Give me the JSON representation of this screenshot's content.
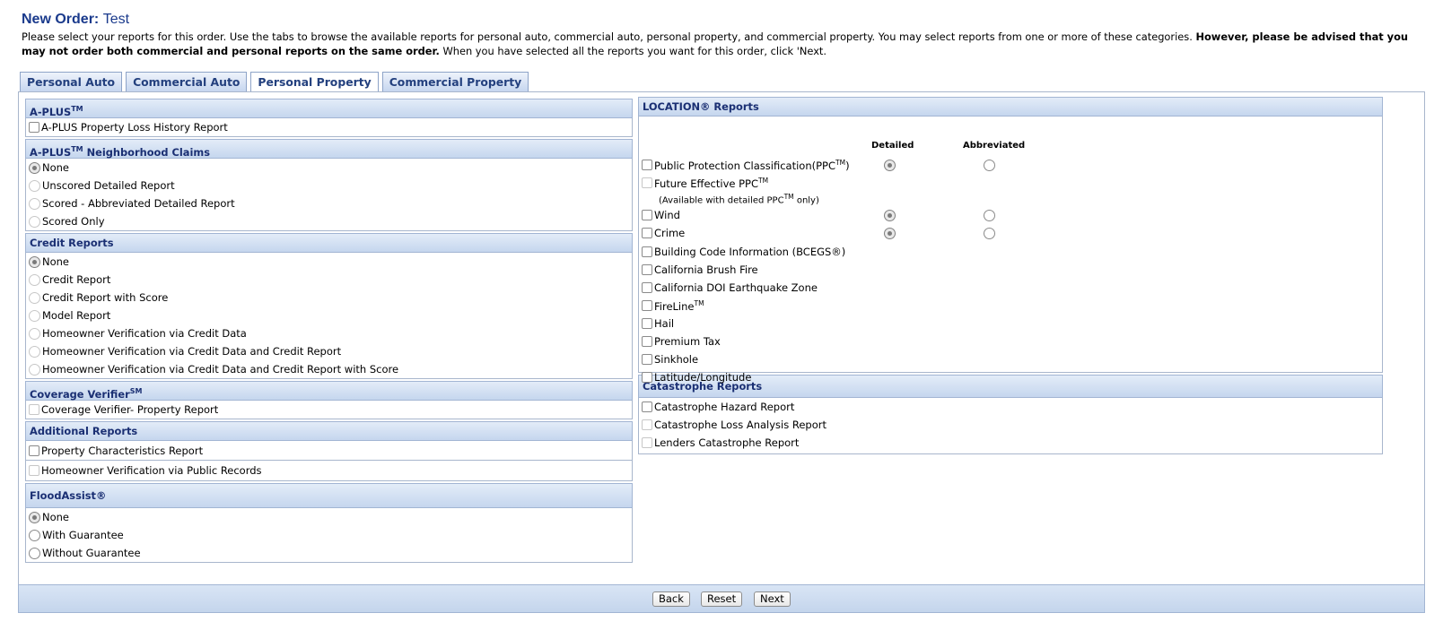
{
  "header": {
    "title_prefix": "New Order:",
    "title_name": "Test",
    "intro_text": "Please select your reports for this order. Use the tabs to browse the available reports for personal auto, commercial auto, personal property, and commercial property. You may select reports from one or more of these categories.",
    "intro_bold": "However, please be advised that you may not order both commercial and personal reports on the same order.",
    "intro_tail": "When you have selected all the reports you want for this order, click 'Next."
  },
  "tabs": [
    {
      "label": "Personal Auto",
      "active": false
    },
    {
      "label": "Commercial Auto",
      "active": false
    },
    {
      "label": "Personal Property",
      "active": true
    },
    {
      "label": "Commercial Property",
      "active": false
    }
  ],
  "left": {
    "aplus": {
      "title": "A-PLUS",
      "title_sup": "TM",
      "items": [
        "A-PLUS Property Loss History Report"
      ]
    },
    "neighborhood": {
      "title": "A-PLUS",
      "title_sup": "TM",
      "title_rest": " Neighborhood Claims",
      "options": [
        "None",
        "Unscored Detailed Report",
        "Scored - Abbreviated Detailed Report",
        "Scored Only"
      ],
      "selected": "None"
    },
    "credit": {
      "title": "Credit Reports",
      "options": [
        "None",
        "Credit Report",
        "Credit Report with Score",
        "Model Report",
        "Homeowner Verification via Credit Data",
        "Homeowner Verification via Credit Data and Credit Report",
        "Homeowner Verification via Credit Data and Credit Report with Score"
      ],
      "selected": "None"
    },
    "coverage": {
      "title": "Coverage Verifier",
      "title_sup": "SM",
      "items": [
        "Coverage Verifier- Property Report"
      ]
    },
    "additional": {
      "title": "Additional Reports",
      "items": [
        "Property Characteristics Report",
        "Homeowner Verification via Public Records"
      ]
    },
    "flood": {
      "title": "FloodAssist®",
      "options": [
        "None",
        "With Guarantee",
        "Without Guarantee"
      ],
      "selected": "None"
    }
  },
  "right": {
    "location": {
      "title": "LOCATION® Reports",
      "col_detailed": "Detailed",
      "col_abbreviated": "Abbreviated",
      "ppc_label": "Public Protection Classification(PPC",
      "ppc_sup": "TM",
      "ppc_close": ")",
      "future_label": "Future Effective PPC",
      "future_sup": "TM",
      "future_note_a": "(Available with detailed PPC",
      "future_note_sup": "TM",
      "future_note_b": " only)",
      "wind": "Wind",
      "crime": "Crime",
      "bcegs": "Building Code Information (BCEGS®)",
      "brush": "California Brush Fire",
      "doi": "California DOI Earthquake Zone",
      "fireline": "FireLine",
      "fireline_sup": "TM",
      "hail": "Hail",
      "premium": "Premium Tax",
      "sinkhole": "Sinkhole",
      "latlong": "Latitude/Longitude"
    },
    "catastrophe": {
      "title": "Catastrophe Reports",
      "items": [
        "Catastrophe Hazard Report",
        "Catastrophe Loss Analysis Report",
        "Lenders Catastrophe Report"
      ]
    }
  },
  "footer": {
    "back": "Back",
    "reset": "Reset",
    "next": "Next"
  }
}
